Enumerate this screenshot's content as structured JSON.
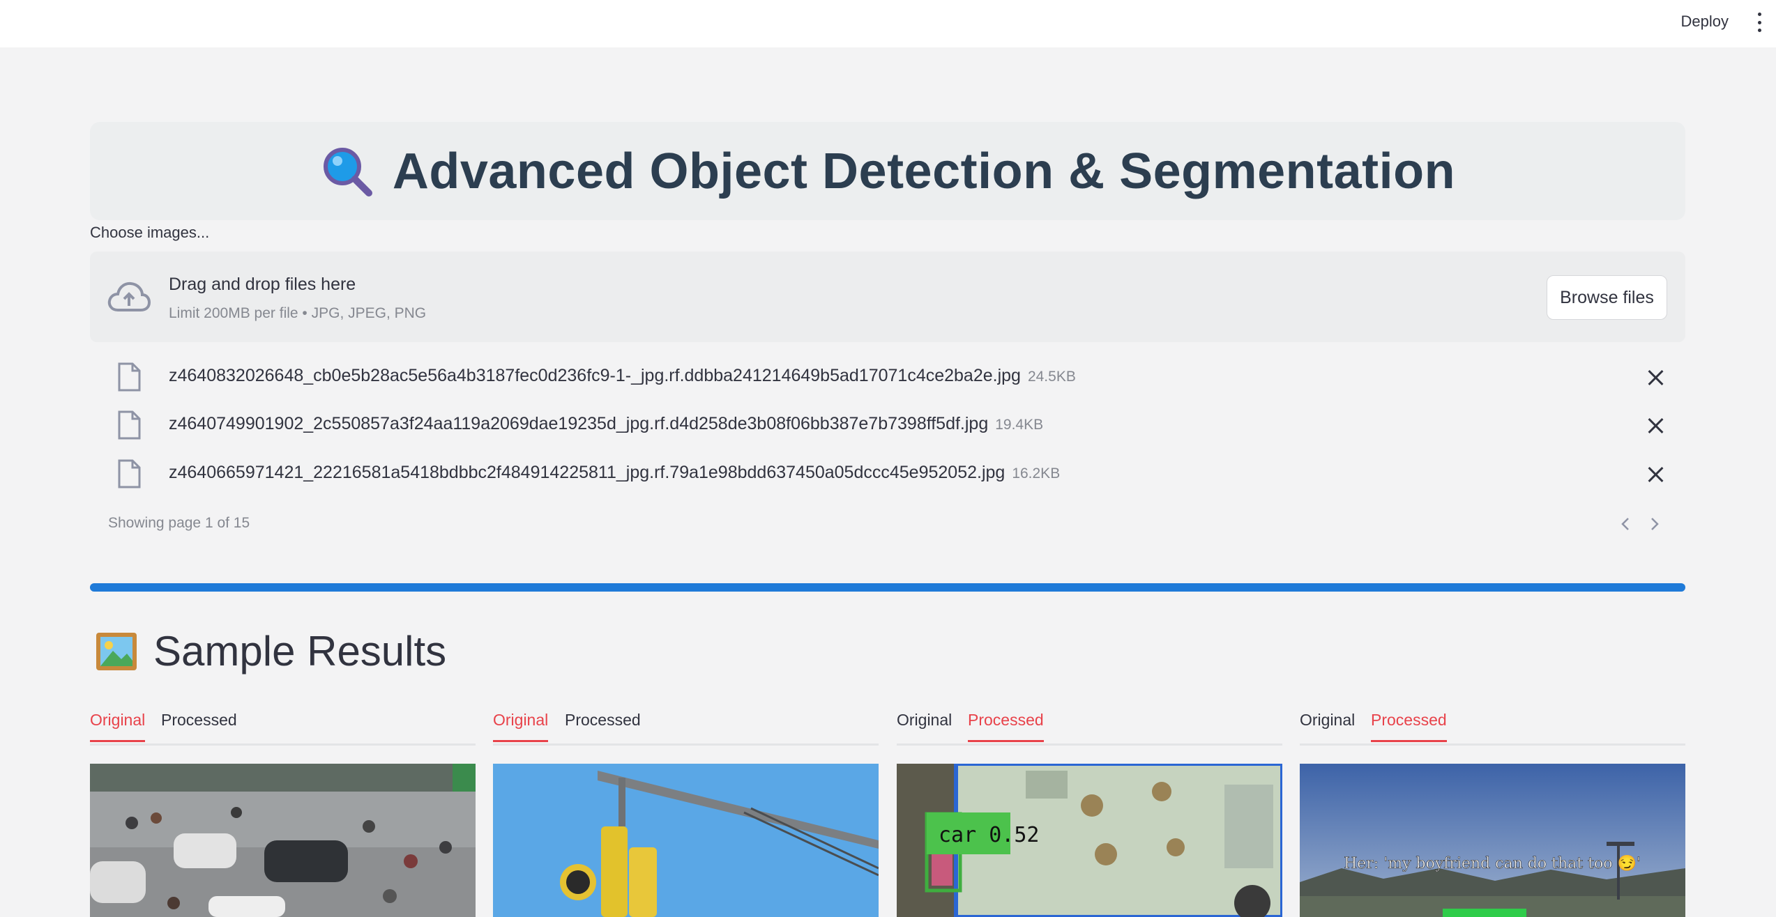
{
  "topbar": {
    "deploy_label": "Deploy",
    "menu_icon": "vertical-dots-icon"
  },
  "header": {
    "title": "Advanced Object Detection & Segmentation",
    "icon": "magnifier-icon"
  },
  "uploader": {
    "label": "Choose images...",
    "drop_title": "Drag and drop files here",
    "drop_subtitle": "Limit 200MB per file • JPG, JPEG, PNG",
    "browse_label": "Browse files",
    "icon": "cloud-upload-icon"
  },
  "files": [
    {
      "name": "z4640832026648_cb0e5b28ac5e56a4b3187fec0d236fc9-1-_jpg.rf.ddbba241214649b5ad17071c4ce2ba2e.jpg",
      "size": "24.5KB"
    },
    {
      "name": "z4640749901902_2c550857a3f24aa119a2069dae19235d_jpg.rf.d4d258de3b08f06bb387e7b7398ff5df.jpg",
      "size": "19.4KB"
    },
    {
      "name": "z4640665971421_22216581a5418bdbbc2f484914225811_jpg.rf.79a1e98bdd637450a05dccc45e952052.jpg",
      "size": "16.2KB"
    }
  ],
  "pagination": {
    "text": "Showing page 1 of 15",
    "current": 1,
    "total": 15
  },
  "progress": {
    "value": 1.0,
    "color": "#1f7ad8"
  },
  "results": {
    "title": "Sample Results",
    "icon": "framed-picture-icon",
    "columns": [
      {
        "tabs": [
          "Original",
          "Processed"
        ],
        "active": 0
      },
      {
        "tabs": [
          "Original",
          "Processed"
        ],
        "active": 0
      },
      {
        "tabs": [
          "Original",
          "Processed"
        ],
        "active": 1,
        "detection_label": "car 0.52"
      },
      {
        "tabs": [
          "Original",
          "Processed"
        ],
        "active": 1,
        "caption": "Her: 'my boyfriend can do that too 😏'"
      }
    ]
  },
  "colors": {
    "accent_red": "#e8424a",
    "title": "#2c3e50",
    "progress": "#1f7ad8"
  }
}
